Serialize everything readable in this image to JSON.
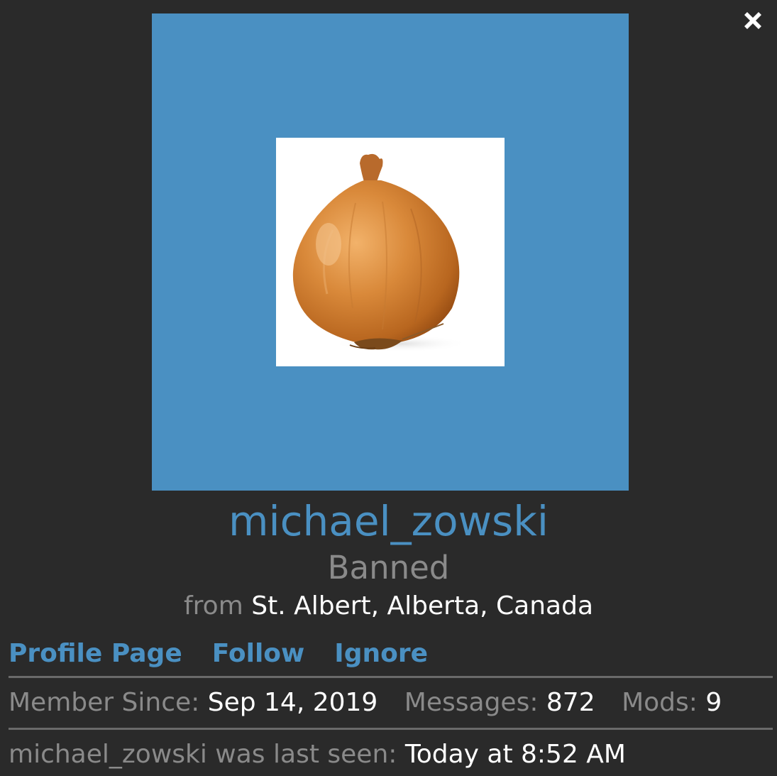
{
  "modal": {
    "close_icon": "close-x-icon",
    "avatar": {
      "background_color": "#4a90c2",
      "image": "onion-avatar-image"
    },
    "username": "michael_zowski",
    "user_title": "Banned",
    "location": {
      "prefix": "from",
      "value": "St. Albert, Alberta, Canada"
    },
    "links": {
      "profile_page": "Profile Page",
      "follow": "Follow",
      "ignore": "Ignore"
    },
    "stats": {
      "member_since_label": "Member Since:",
      "member_since_value": "Sep 14, 2019",
      "messages_label": "Messages:",
      "messages_value": "872",
      "mods_label": "Mods:",
      "mods_value": "9"
    },
    "last_seen": {
      "label": "michael_zowski was last seen:",
      "value": "Today at 8:52 AM"
    },
    "colors": {
      "background": "#2a2a2a",
      "accent": "#4a90c2",
      "muted_text": "#8a8a8a",
      "primary_text": "#ffffff"
    }
  }
}
